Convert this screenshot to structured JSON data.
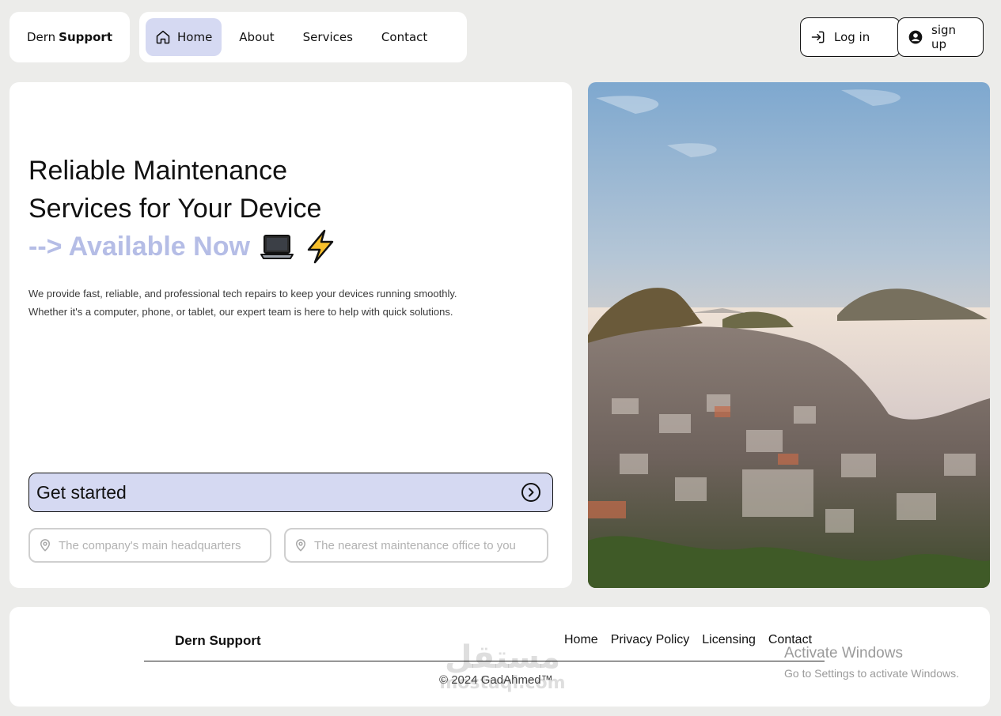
{
  "brand": {
    "name_regular": "Dern",
    "name_bold": "Support"
  },
  "nav": {
    "items": [
      {
        "label": "Home",
        "icon": "home-icon",
        "active": true
      },
      {
        "label": "About"
      },
      {
        "label": "Services"
      },
      {
        "label": "Contact"
      }
    ]
  },
  "auth": {
    "login_label": "Log in",
    "login_icon": "login-icon",
    "signup_label": "sign up",
    "signup_icon": "user-circle-icon"
  },
  "hero": {
    "headline_line1": "Reliable Maintenance",
    "headline_line2": "Services for Your Device",
    "accent_text": "--> Available Now",
    "emoji_icons": [
      "laptop-icon",
      "lightning-icon"
    ],
    "description_line1": "We provide fast, reliable, and professional tech repairs to keep your devices running smoothly.",
    "description_line2": "Whether it's a computer, phone, or tablet, our expert team is here to help with quick solutions.",
    "cta_label": "Get started",
    "cta_icon": "arrow-circle-right-icon",
    "location_pills": [
      {
        "label": "The company's main headquarters",
        "icon": "location-pin-icon"
      },
      {
        "label": "The nearest maintenance office to you",
        "icon": "location-pin-icon"
      }
    ]
  },
  "photo": {
    "subject": "coastal-town-aerial-photo"
  },
  "footer": {
    "brand": "Dern Support",
    "links": [
      "Home",
      "Privacy Policy",
      "Licensing",
      "Contact"
    ],
    "copyright": "© 2024 GadAhmed™"
  },
  "watermark": {
    "arabic": "مستقل",
    "latin": "mostaqi.com"
  },
  "os_overlay": {
    "line1": "Activate Windows",
    "line2": "Go to Settings to activate Windows."
  },
  "colors": {
    "page_bg": "#ececea",
    "accent": "#d5d9f2",
    "accent_text": "#b5bde6"
  }
}
